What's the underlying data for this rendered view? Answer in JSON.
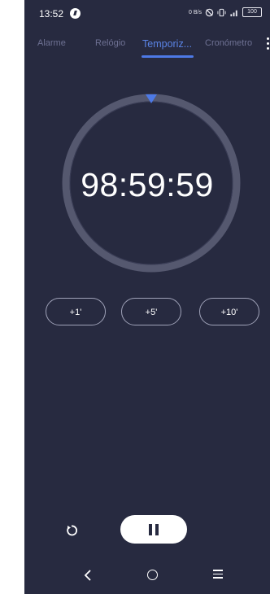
{
  "status_bar": {
    "time": "13:52",
    "network_speed": "0 B/s",
    "battery_level": "100",
    "icons": [
      "alert-icon",
      "silent-icon",
      "vibrate-icon",
      "signal-icon",
      "battery-icon"
    ]
  },
  "tabs": [
    {
      "label": "Alarme",
      "active": false
    },
    {
      "label": "Relógio",
      "active": false
    },
    {
      "label": "Temporiz...",
      "active": true
    },
    {
      "label": "Cronómetro",
      "active": false
    }
  ],
  "timer": {
    "display": "98:59:59",
    "progress": 1.0
  },
  "quick_add": [
    "+1'",
    "+5'",
    "+10'"
  ],
  "colors": {
    "background": "#272a40",
    "accent": "#4d79e6",
    "ring": "#55586f",
    "text": "#ffffff",
    "inactive_tab": "#6e7193"
  }
}
